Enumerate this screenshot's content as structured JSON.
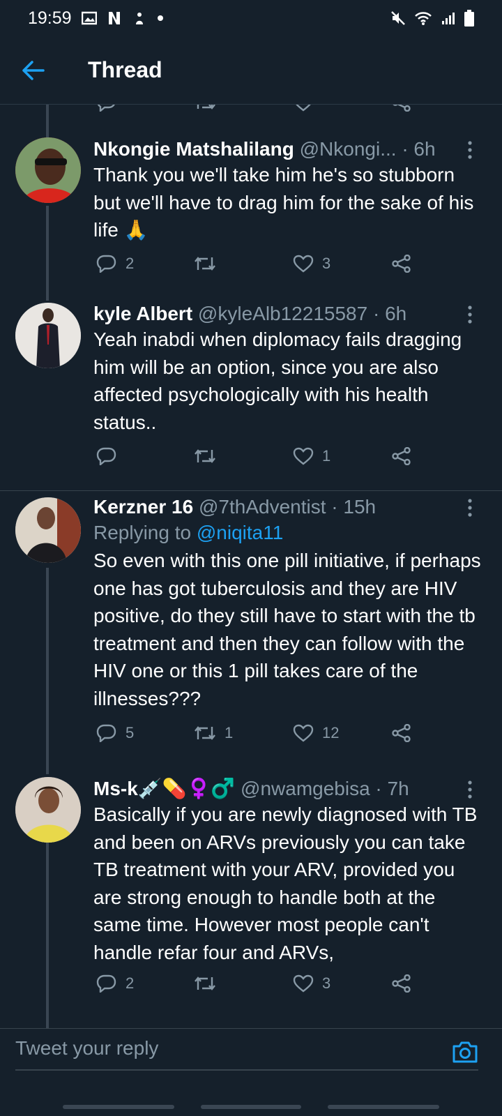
{
  "status": {
    "time": "19:59"
  },
  "header": {
    "title": "Thread"
  },
  "tweets": [
    {
      "name": "Nkongie Matshalilang",
      "handle": "@Nkongi...",
      "time": "· 6h",
      "text": "Thank you we'll take him he's so stubborn but we'll have to drag him for the sake of his life 🙏",
      "replies": "2",
      "retweets": "",
      "likes": "3"
    },
    {
      "name": "kyle Albert",
      "handle": "@kyleAlb12215587 · 6h",
      "time": "",
      "text": "Yeah inabdi when diplomacy fails dragging him will be an option, since you are also affected psychologically with his health status..",
      "replies": "",
      "retweets": "",
      "likes": "1"
    },
    {
      "name": "Kerzner 16",
      "handle": "@7thAdventist · 15h",
      "time": "",
      "replying_prefix": "Replying to ",
      "replying_to": "@niqita11",
      "text": "So even with this one pill initiative, if perhaps one has got tuberculosis and they are HIV positive, do they still have to start with the tb treatment and then they can follow with the HIV one or this 1 pill takes care of the illnesses???",
      "replies": "5",
      "retweets": "1",
      "likes": "12"
    },
    {
      "name": "Ms-k💉💊♀️♂️",
      "handle": "@nwamgebisa · 7h",
      "time": "",
      "text": "Basically if you are newly diagnosed with TB and been on ARVs  previously you can take TB treatment with your ARV, provided you are strong enough to handle both at the same time. However most people can't handle refar four and ARVs,",
      "replies": "2",
      "retweets": "",
      "likes": "3"
    }
  ],
  "reply_bar": {
    "placeholder": "Tweet your reply"
  },
  "colors": {
    "background": "#15202b",
    "accent": "#1da1f2",
    "muted": "#8899a6"
  }
}
